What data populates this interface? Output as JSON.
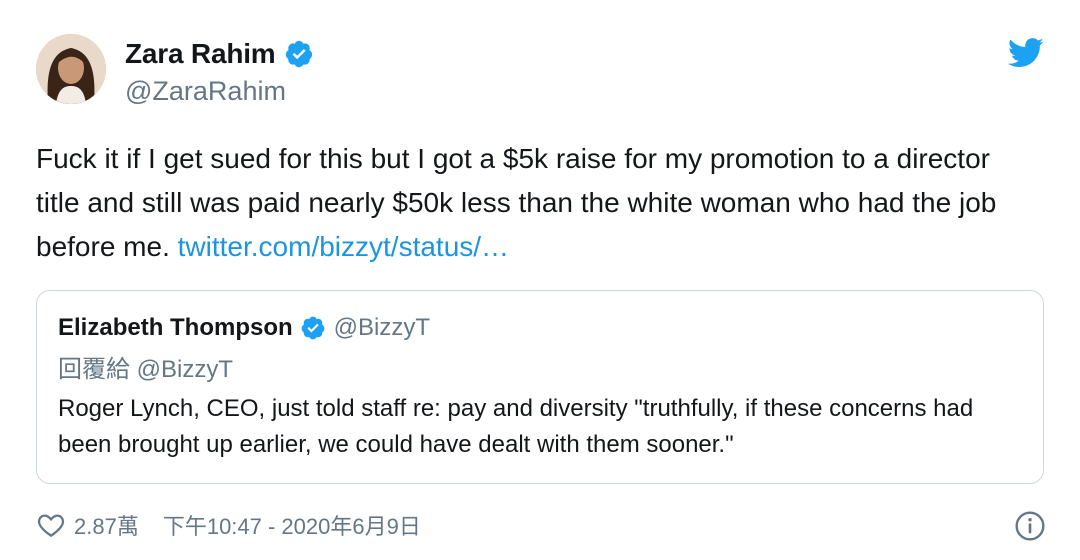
{
  "author": {
    "name": "Zara Rahim",
    "handle": "@ZaraRahim"
  },
  "tweet": {
    "text": "Fuck it if I get sued for this but I got a $5k raise for my promotion to a director title and still was paid nearly $50k less than the white woman who had the job before me. ",
    "link": "twitter.com/bizzyt/status/…"
  },
  "quoted_tweet": {
    "name": "Elizabeth Thompson",
    "handle": "@BizzyT",
    "reply_to": "回覆給 @BizzyT",
    "text": "Roger Lynch, CEO, just told staff re: pay and diversity \"truthfully, if these concerns had been brought up earlier, we could have dealt with them sooner.\""
  },
  "footer": {
    "likes": "2.87萬",
    "timestamp": "下午10:47 - 2020年6月9日"
  },
  "icons": {
    "verified": "verified-badge-icon",
    "brand": "twitter-bird-icon",
    "like": "heart-icon",
    "info": "info-icon"
  },
  "colors": {
    "accent": "#1da1f2",
    "link": "#1b95e0",
    "text": "#14171a",
    "secondary": "#657786",
    "border": "#ccd6dd"
  }
}
